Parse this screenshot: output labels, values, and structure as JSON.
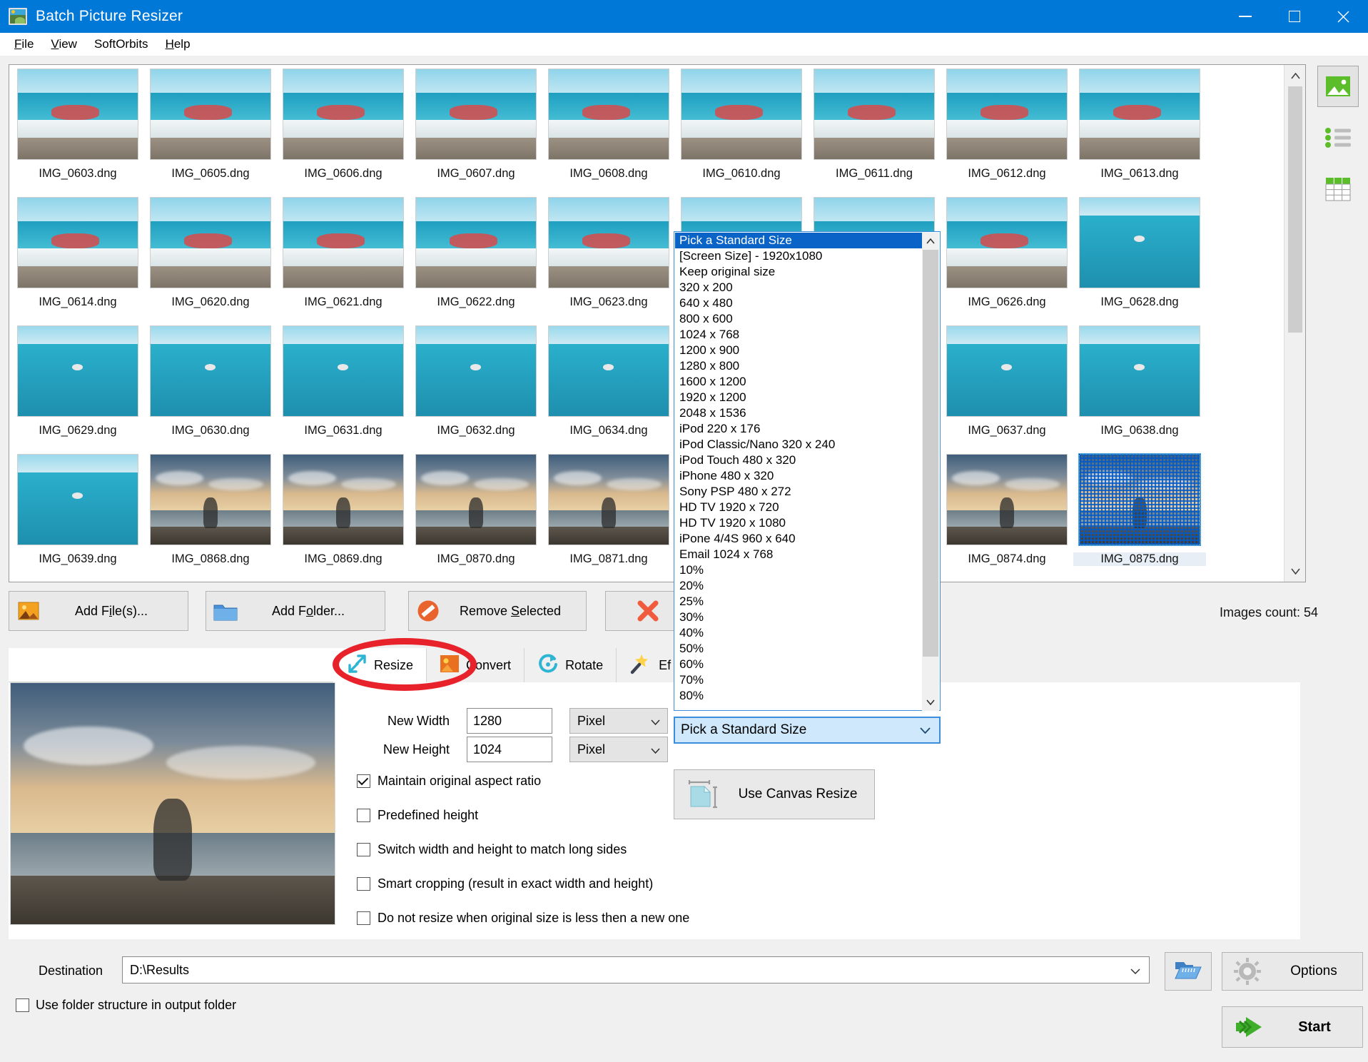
{
  "window": {
    "title": "Batch Picture Resizer",
    "app_icon": "picture-icon",
    "minimize": "minimize-icon",
    "maximize": "maximize-icon",
    "close": "close-icon"
  },
  "menubar": {
    "items": [
      {
        "label": "File",
        "accel": "F"
      },
      {
        "label": "View",
        "accel": "V"
      },
      {
        "label": "SoftOrbits",
        "accel": ""
      },
      {
        "label": "Help",
        "accel": "H"
      }
    ]
  },
  "thumbnails": [
    {
      "name": "IMG_0603.dng",
      "scene": "sea",
      "selected": false
    },
    {
      "name": "IMG_0605.dng",
      "scene": "sea",
      "selected": false
    },
    {
      "name": "IMG_0606.dng",
      "scene": "sea",
      "selected": false
    },
    {
      "name": "IMG_0607.dng",
      "scene": "sea",
      "selected": false
    },
    {
      "name": "IMG_0608.dng",
      "scene": "sea",
      "selected": false
    },
    {
      "name": "IMG_0610.dng",
      "scene": "sea",
      "selected": false
    },
    {
      "name": "IMG_0611.dng",
      "scene": "sea",
      "selected": false
    },
    {
      "name": "IMG_0612.dng",
      "scene": "sea",
      "selected": false
    },
    {
      "name": "IMG_0613.dng",
      "scene": "sea",
      "selected": false
    },
    {
      "name": "IMG_0614.dng",
      "scene": "sea",
      "selected": false
    },
    {
      "name": "IMG_0620.dng",
      "scene": "sea",
      "selected": false
    },
    {
      "name": "IMG_0621.dng",
      "scene": "sea",
      "selected": false
    },
    {
      "name": "IMG_0622.dng",
      "scene": "sea",
      "selected": false
    },
    {
      "name": "IMG_0623.dng",
      "scene": "sea",
      "selected": false
    },
    {
      "name": "",
      "scene": "sea",
      "selected": false
    },
    {
      "name": "",
      "scene": "sea",
      "selected": false
    },
    {
      "name": "IMG_0626.dng",
      "scene": "sea",
      "selected": false
    },
    {
      "name": "IMG_0628.dng",
      "scene": "open",
      "selected": false
    },
    {
      "name": "IMG_0629.dng",
      "scene": "open",
      "selected": false
    },
    {
      "name": "IMG_0630.dng",
      "scene": "open",
      "selected": false
    },
    {
      "name": "IMG_0631.dng",
      "scene": "open",
      "selected": false
    },
    {
      "name": "IMG_0632.dng",
      "scene": "open",
      "selected": false
    },
    {
      "name": "IMG_0634.dng",
      "scene": "open",
      "selected": false
    },
    {
      "name": "",
      "scene": "open",
      "selected": false
    },
    {
      "name": "",
      "scene": "open",
      "selected": false
    },
    {
      "name": "IMG_0637.dng",
      "scene": "open",
      "selected": false
    },
    {
      "name": "IMG_0638.dng",
      "scene": "open",
      "selected": false
    },
    {
      "name": "IMG_0639.dng",
      "scene": "open",
      "selected": false
    },
    {
      "name": "IMG_0868.dng",
      "scene": "sun",
      "selected": false
    },
    {
      "name": "IMG_0869.dng",
      "scene": "sun",
      "selected": false
    },
    {
      "name": "IMG_0870.dng",
      "scene": "sun",
      "selected": false
    },
    {
      "name": "IMG_0871.dng",
      "scene": "sun",
      "selected": false
    },
    {
      "name": "",
      "scene": "sun",
      "selected": false
    },
    {
      "name": "",
      "scene": "sun",
      "selected": false
    },
    {
      "name": "IMG_0874.dng",
      "scene": "sun",
      "selected": false
    },
    {
      "name": "IMG_0875.dng",
      "scene": "sun",
      "selected": true
    }
  ],
  "view_buttons": [
    {
      "icon": "thumbnail-view-icon",
      "active": true
    },
    {
      "icon": "list-view-icon",
      "active": false
    },
    {
      "icon": "details-grid-view-icon",
      "active": false
    }
  ],
  "actions": {
    "add_files": "Add File(s)...",
    "add_files_accel": "i",
    "add_folder": "Add Folder...",
    "add_folder_accel": "o",
    "remove_selected": "Remove Selected",
    "remove_selected_accel": "S",
    "clear_all": "",
    "images_count": "Images count: 54"
  },
  "tabs": [
    {
      "label": "Resize",
      "icon": "resize-arrow-icon",
      "active": true
    },
    {
      "label": "Convert",
      "icon": "convert-image-icon",
      "active": false
    },
    {
      "label": "Rotate",
      "icon": "rotate-circle-icon",
      "active": false
    },
    {
      "label": "Ef",
      "icon": "effects-wand-icon",
      "active": false
    }
  ],
  "resize_form": {
    "new_width_label": "New Width",
    "new_width_value": "1280",
    "new_width_unit": "Pixel",
    "new_height_label": "New Height",
    "new_height_value": "1024",
    "new_height_unit": "Pixel",
    "checkboxes": [
      {
        "label": "Maintain original aspect ratio",
        "checked": true
      },
      {
        "label": "Predefined height",
        "checked": false
      },
      {
        "label": "Switch width and height to match long sides",
        "checked": false
      },
      {
        "label": "Smart cropping (result in exact width and height)",
        "checked": false
      },
      {
        "label": "Do not resize when original size is less then a new one",
        "checked": false
      }
    ],
    "canvas_resize_button": "Use Canvas Resize",
    "canvas_resize_icon": "canvas-resize-icon"
  },
  "standard_size_dropdown": {
    "combo_value": "Pick a Standard Size",
    "selected_option": "Pick a Standard Size",
    "options": [
      "Pick a Standard Size",
      "[Screen Size] - 1920x1080",
      "Keep original size",
      "320 x 200",
      "640 x 480",
      "800 x 600",
      "1024 x 768",
      "1200 x 900",
      "1280 x 800",
      "1600 x 1200",
      "1920 x 1200",
      "2048 x 1536",
      "iPod 220 x 176",
      "iPod Classic/Nano 320 x 240",
      "iPod Touch 480 x 320",
      "iPhone 480 x 320",
      "Sony PSP 480 x 272",
      "HD TV 1920 x 720",
      "HD TV 1920 x 1080",
      "iPone 4/4S 960 x 640",
      "Email 1024 x 768",
      "10%",
      "20%",
      "25%",
      "30%",
      "40%",
      "50%",
      "60%",
      "70%",
      "80%"
    ]
  },
  "destination": {
    "label": "Destination",
    "value": "D:\\Results",
    "browse_icon": "open-folder-icon",
    "use_folder_structure_label": "Use folder structure in output folder",
    "use_folder_structure_checked": false
  },
  "footer": {
    "options_label": "Options",
    "options_icon": "gear-icon",
    "start_label": "Start",
    "start_icon": "green-arrow-icon"
  },
  "annotation": {
    "highlight_target": "Resize tab",
    "color": "#e8222a"
  },
  "colors": {
    "titlebar": "#0078d7",
    "accent_selection": "#0a64c8",
    "window_bg": "#f0f0f0",
    "annotation_red": "#e8222a"
  }
}
